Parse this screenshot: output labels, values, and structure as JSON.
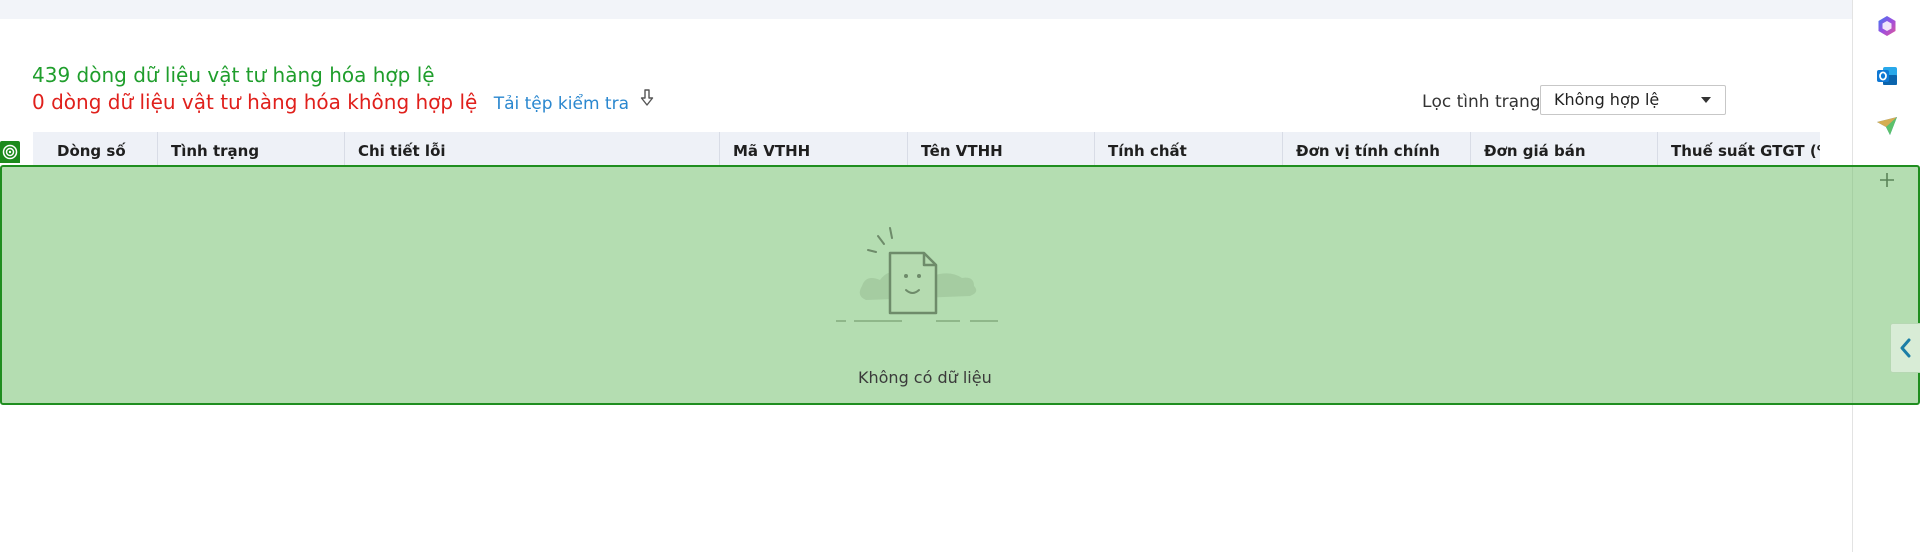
{
  "summary": {
    "valid_text": "439 dòng dữ liệu vật tư hàng hóa hợp lệ",
    "invalid_text": "0 dòng dữ liệu vật tư hàng hóa không hợp lệ",
    "download_label": "Tải tệp kiểm tra"
  },
  "filter": {
    "label": "Lọc tình trạng",
    "selected": "Không hợp lệ"
  },
  "table": {
    "columns": [
      "Dòng số",
      "Tình trạng",
      "Chi tiết lỗi",
      "Mã VTHH",
      "Tên VTHH",
      "Tính chất",
      "Đơn vị tính chính",
      "Đơn giá bán",
      "Thuế suất GTGT (%)"
    ],
    "empty_text": "Không có dữ liệu"
  },
  "colors": {
    "valid": "#1f9e2c",
    "invalid": "#e0201c",
    "link": "#2a87cf",
    "overlay_border": "#1f8e1f"
  },
  "icons": {
    "download": "download-arrow-icon",
    "rail": [
      "copilot-icon",
      "outlook-icon",
      "send-icon",
      "plus-icon"
    ],
    "collapse": "chevron-left-icon",
    "empty": "empty-document-icon"
  }
}
